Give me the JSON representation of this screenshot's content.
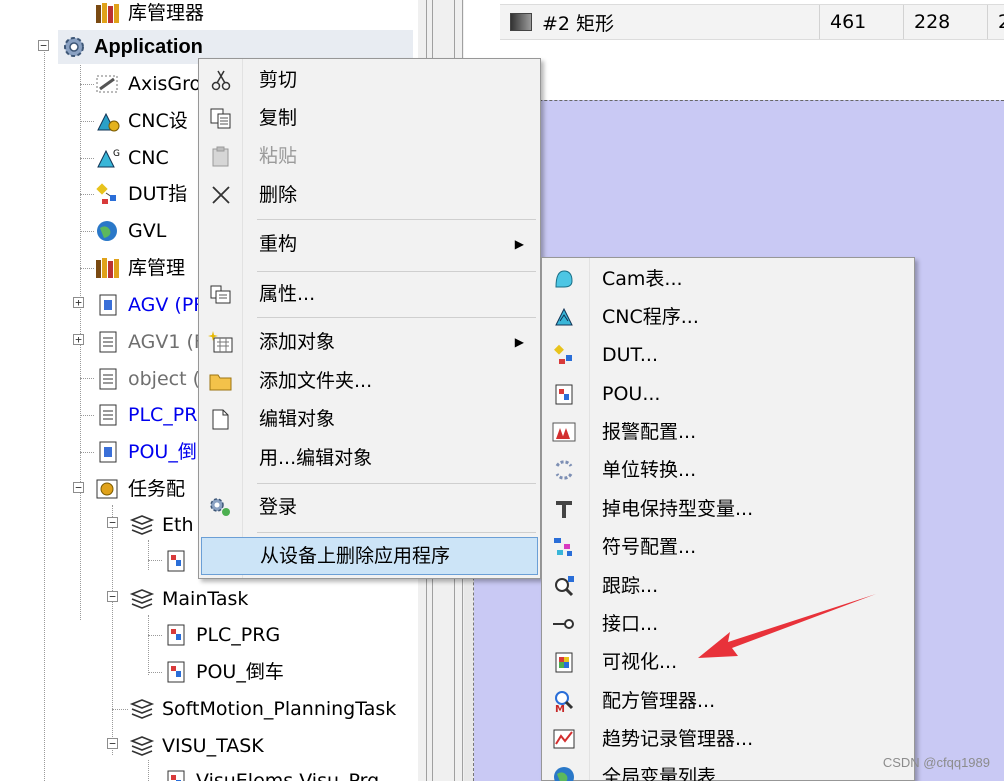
{
  "tree": {
    "items": [
      {
        "label": "库管理器",
        "icon": "library-manager-icon",
        "style": "normal"
      },
      {
        "label": "Application",
        "icon": "gear-icon",
        "style": "bold"
      },
      {
        "label": "AxisGro",
        "icon": "axis-group-icon",
        "style": "normal"
      },
      {
        "label": "CNC设",
        "icon": "cnc-settings-icon",
        "style": "normal"
      },
      {
        "label": "CNC",
        "icon": "cnc-icon",
        "style": "normal"
      },
      {
        "label": "DUT指",
        "icon": "dut-icon",
        "style": "normal"
      },
      {
        "label": "GVL",
        "icon": "globe-icon",
        "style": "normal"
      },
      {
        "label": "库管理",
        "icon": "library-manager-icon",
        "style": "normal"
      },
      {
        "label": "AGV (PR",
        "icon": "pou-icon",
        "style": "blue"
      },
      {
        "label": "AGV1 (F",
        "icon": "document-icon",
        "style": "gray"
      },
      {
        "label": "object (",
        "icon": "document-icon",
        "style": "gray"
      },
      {
        "label": "PLC_PRG",
        "icon": "document-icon",
        "style": "blue"
      },
      {
        "label": "POU_倒",
        "icon": "pou-icon",
        "style": "blue"
      },
      {
        "label": "任务配",
        "icon": "task-config-icon",
        "style": "normal"
      },
      {
        "label": "Eth",
        "icon": "task-icon",
        "style": "normal"
      },
      {
        "label": "",
        "icon": "pou-call-icon",
        "style": "normal"
      },
      {
        "label": "MainTask",
        "icon": "task-icon",
        "style": "normal"
      },
      {
        "label": "PLC_PRG",
        "icon": "pou-call-icon",
        "style": "normal"
      },
      {
        "label": "POU_倒车",
        "icon": "pou-call-icon",
        "style": "normal"
      },
      {
        "label": "SoftMotion_PlanningTask",
        "icon": "task-icon",
        "style": "normal"
      },
      {
        "label": "VISU_TASK",
        "icon": "task-icon",
        "style": "normal"
      },
      {
        "label": "VisuElems.Visu_Prg",
        "icon": "pou-call-icon",
        "style": "normal"
      }
    ]
  },
  "table": {
    "row": {
      "name": "#2 矩形",
      "col2": "461",
      "col3": "228",
      "col4": "2"
    }
  },
  "context_menu": {
    "items": [
      {
        "label": "剪切",
        "icon": "scissors-icon",
        "enabled": true
      },
      {
        "label": "复制",
        "icon": "copy-icon",
        "enabled": true
      },
      {
        "label": "粘贴",
        "icon": "paste-icon",
        "enabled": false
      },
      {
        "label": "删除",
        "icon": "delete-icon",
        "enabled": true
      },
      {
        "label": "重构",
        "icon": "",
        "enabled": true,
        "submenu": true
      },
      {
        "label": "属性...",
        "icon": "properties-icon",
        "enabled": true
      },
      {
        "label": "添加对象",
        "icon": "add-object-icon",
        "enabled": true,
        "submenu": true
      },
      {
        "label": "添加文件夹...",
        "icon": "folder-icon",
        "enabled": true
      },
      {
        "label": "编辑对象",
        "icon": "edit-object-icon",
        "enabled": true
      },
      {
        "label": "用...编辑对象",
        "icon": "",
        "enabled": true
      },
      {
        "label": "登录",
        "icon": "login-icon",
        "enabled": true
      },
      {
        "label": "从设备上删除应用程序",
        "icon": "",
        "enabled": true,
        "highlight": true
      }
    ]
  },
  "submenu": {
    "items": [
      {
        "label": "Cam表...",
        "icon": "cam-table-icon"
      },
      {
        "label": "CNC程序...",
        "icon": "cnc-program-icon"
      },
      {
        "label": "DUT...",
        "icon": "dut-icon"
      },
      {
        "label": "POU...",
        "icon": "pou-icon"
      },
      {
        "label": "报警配置...",
        "icon": "alarm-config-icon"
      },
      {
        "label": "单位转换...",
        "icon": "unit-conversion-icon"
      },
      {
        "label": "掉电保持型变量...",
        "icon": "persistent-vars-icon"
      },
      {
        "label": "符号配置...",
        "icon": "symbol-config-icon"
      },
      {
        "label": "跟踪...",
        "icon": "trace-icon"
      },
      {
        "label": "接口...",
        "icon": "interface-icon"
      },
      {
        "label": "可视化...",
        "icon": "visualization-icon"
      },
      {
        "label": "配方管理器...",
        "icon": "recipe-manager-icon"
      },
      {
        "label": "趋势记录管理器...",
        "icon": "trend-manager-icon"
      },
      {
        "label": "全局变量列表",
        "icon": "globe-icon"
      }
    ]
  },
  "colors": {
    "canvas_background": "#c9c9f4",
    "menu_highlight": "#cce4f7",
    "annotation_arrow": "#e8323a",
    "link_blue": "#0000ee"
  },
  "watermark": "CSDN @cfqq1989"
}
